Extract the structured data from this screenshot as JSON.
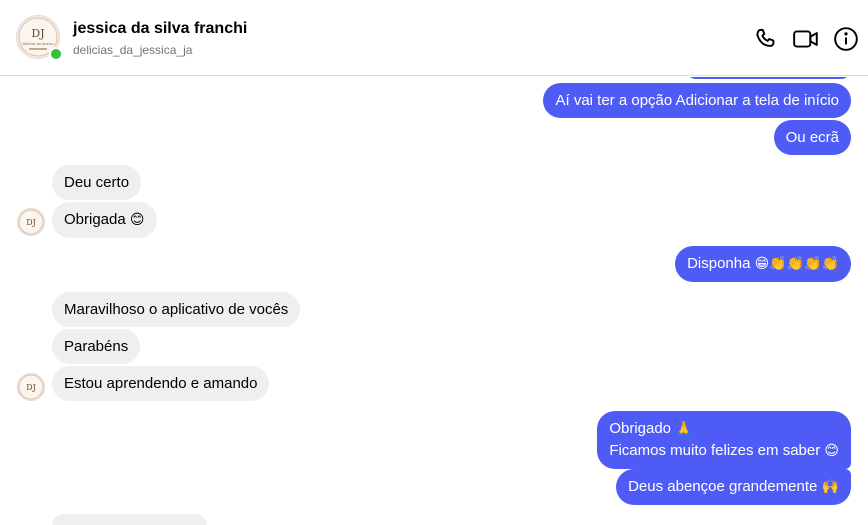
{
  "header": {
    "name": "jessica da silva franchi",
    "handle": "delicias_da_jessica_ja",
    "avatar_label": "Delicias da Jessica",
    "call_icon": "phone-icon",
    "video_icon": "video-camera-icon",
    "info_icon": "info-icon"
  },
  "messages": {
    "m1": "Aí vai ter a opção Adicionar a tela de início",
    "m2": "Ou ecrã",
    "m3": "Deu certo",
    "m4": "Obrigada",
    "m5": "Disponha",
    "m6": "Maravilhoso o aplicativo de vocês",
    "m7": "Parabéns",
    "m8": "Estou aprendendo e amando",
    "m9_line1": "Obrigado",
    "m9_line2": "Ficamos muito felizes em saber",
    "m10": "Deus abençoe grandemente"
  },
  "emojis": {
    "smiling_blush": "😊",
    "grin": "😁",
    "clap": "👏",
    "pray": "🙏",
    "raised_hands": "🙌"
  },
  "colors": {
    "outgoing_bubble": "#4e5cf5",
    "incoming_bubble": "#efefef",
    "online": "#31c23b"
  }
}
